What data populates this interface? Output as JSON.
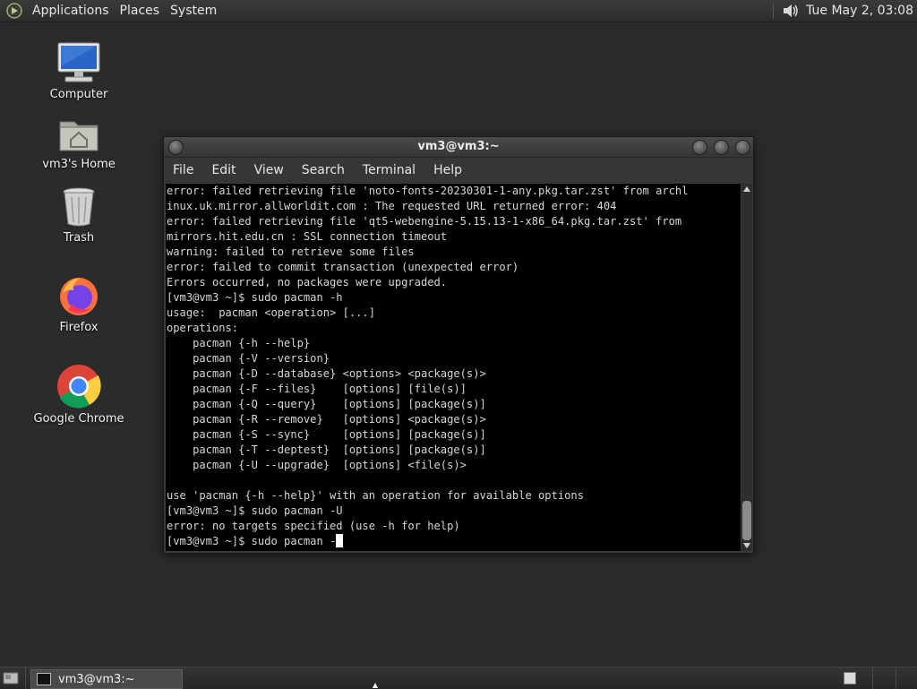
{
  "top_panel": {
    "menus": [
      "Applications",
      "Places",
      "System"
    ],
    "clock": "Tue May  2, 03:08"
  },
  "desktop_icons": [
    {
      "label": "Computer",
      "icon": "computer-icon"
    },
    {
      "label": "vm3's Home",
      "icon": "home-folder-icon"
    },
    {
      "label": "Trash",
      "icon": "trash-icon"
    },
    {
      "label": "Firefox",
      "icon": "firefox-icon"
    },
    {
      "label": "Google Chrome",
      "icon": "chrome-icon"
    }
  ],
  "window": {
    "title": "vm3@vm3:~",
    "menu": [
      "File",
      "Edit",
      "View",
      "Search",
      "Terminal",
      "Help"
    ]
  },
  "terminal": {
    "lines": [
      "error: failed retrieving file 'noto-fonts-20230301-1-any.pkg.tar.zst' from archl",
      "inux.uk.mirror.allworldit.com : The requested URL returned error: 404",
      "error: failed retrieving file 'qt5-webengine-5.15.13-1-x86_64.pkg.tar.zst' from",
      "mirrors.hit.edu.cn : SSL connection timeout",
      "warning: failed to retrieve some files",
      "error: failed to commit transaction (unexpected error)",
      "Errors occurred, no packages were upgraded.",
      "[vm3@vm3 ~]$ sudo pacman -h",
      "usage:  pacman <operation> [...]",
      "operations:",
      "    pacman {-h --help}",
      "    pacman {-V --version}",
      "    pacman {-D --database} <options> <package(s)>",
      "    pacman {-F --files}    [options] [file(s)]",
      "    pacman {-Q --query}    [options] [package(s)]",
      "    pacman {-R --remove}   [options] <package(s)>",
      "    pacman {-S --sync}     [options] [package(s)]",
      "    pacman {-T --deptest}  [options] [package(s)]",
      "    pacman {-U --upgrade}  [options] <file(s)>",
      "",
      "use 'pacman {-h --help}' with an operation for available options",
      "[vm3@vm3 ~]$ sudo pacman -U",
      "error: no targets specified (use -h for help)"
    ],
    "prompt": "[vm3@vm3 ~]$ sudo pacman -"
  },
  "taskbar": {
    "task_label": "vm3@vm3:~"
  }
}
